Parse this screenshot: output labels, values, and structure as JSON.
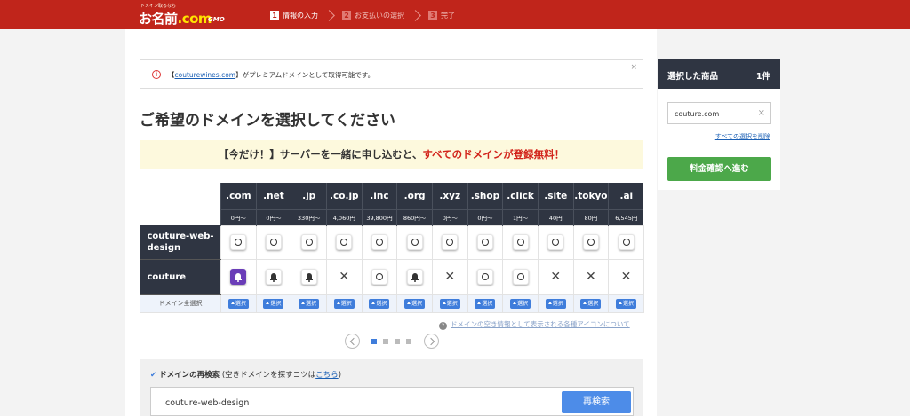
{
  "header": {
    "logo_tag": "ドメイン取るなら",
    "logo_text": "お名前",
    "logo_dot": ".com",
    "logo_gmo": "GMO",
    "steps": [
      {
        "num": "1",
        "label": "情報の入力"
      },
      {
        "num": "2",
        "label": "お支払いの選択"
      },
      {
        "num": "3",
        "label": "完了"
      }
    ]
  },
  "notice": {
    "icon": "info-icon",
    "bracket_open": "【",
    "domain": "couturewines.com",
    "rest": "】がプレミアムドメインとして取得可能です。",
    "close": "×"
  },
  "page_title": "ご希望のドメインを選択してください",
  "promo": {
    "prefix": "【今だけ！】サーバーを一緒に申し込むと、",
    "highlight": "すべてのドメインが登録無料！"
  },
  "table": {
    "tlds": [
      {
        "name": ".com",
        "price": "0円〜"
      },
      {
        "name": ".net",
        "price": "0円〜"
      },
      {
        "name": ".jp",
        "price": "330円〜"
      },
      {
        "name": ".co.jp",
        "price": "4,060円"
      },
      {
        "name": ".inc",
        "price": "39,800円"
      },
      {
        "name": ".org",
        "price": "860円〜"
      },
      {
        "name": ".xyz",
        "price": "0円〜"
      },
      {
        "name": ".shop",
        "price": "0円〜"
      },
      {
        "name": ".click",
        "price": "1円〜"
      },
      {
        "name": ".site",
        "price": "40円"
      },
      {
        "name": ".tokyo",
        "price": "80円"
      },
      {
        "name": ".ai",
        "price": "6,545円"
      }
    ],
    "rows": [
      {
        "label": "couture-web-design",
        "status": [
          "available",
          "available",
          "available",
          "available",
          "available",
          "available",
          "available",
          "available",
          "available",
          "available",
          "available",
          "available"
        ]
      },
      {
        "label": "couture",
        "status": [
          "selected",
          "bell",
          "bell",
          "taken",
          "available",
          "bell",
          "taken",
          "available",
          "available",
          "taken",
          "taken",
          "taken"
        ]
      }
    ],
    "select_all_label": "ドメイン全選択",
    "select_button": "選択"
  },
  "help_link": "ドメインの空き情報として表示される各種アイコンについて",
  "pager": {
    "pages": 4,
    "current": 1
  },
  "research": {
    "check": "✔",
    "title": "ドメインの再検索",
    "hint_prefix": "(空きドメインを探すコツは",
    "hint_link": "こちら",
    "hint_suffix": ")",
    "input_value": "couture-web-design",
    "button": "再検索"
  },
  "sidebar": {
    "title": "選択した商品",
    "count": "1件",
    "item": "couture.com",
    "item_remove": "×",
    "clear_all": "すべての選択を削除",
    "proceed": "料金確認へ進む"
  }
}
